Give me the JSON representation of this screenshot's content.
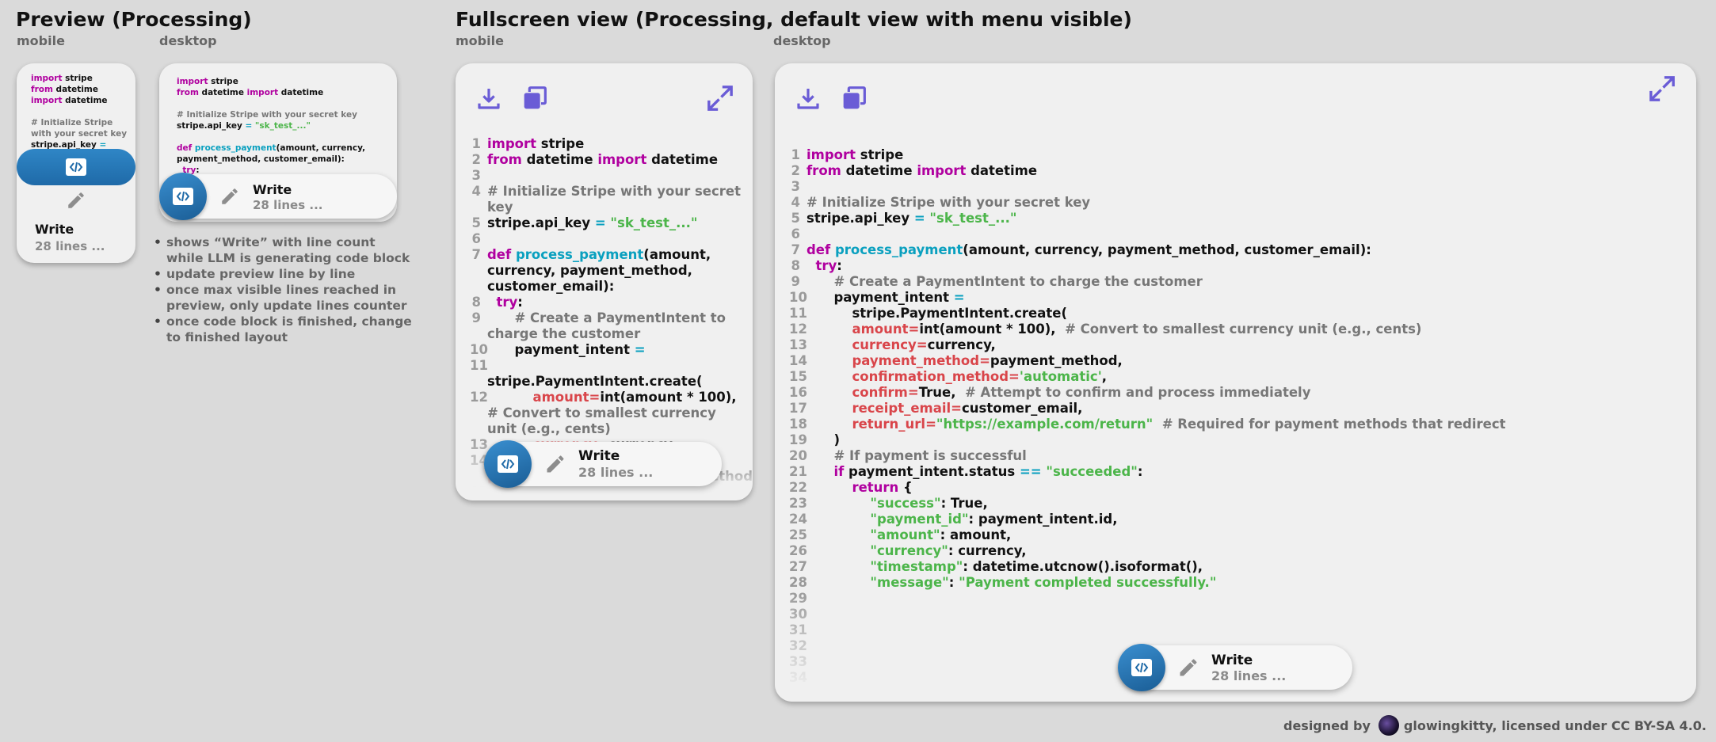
{
  "headings": {
    "preview": "Preview (Processing)",
    "fullscreen": "Fullscreen view (Processing, default view with menu visible)",
    "mobile": "mobile",
    "desktop": "desktop"
  },
  "write": {
    "title": "Write",
    "lines": "28 lines ..."
  },
  "notes": [
    "shows “Write” with line count while LLM is generating code block",
    "update preview line by line",
    "once max visible lines reached in preview, only update lines counter",
    "once code block is finished, change to finished layout"
  ],
  "credit": {
    "designed_by": "designed by",
    "author": "glowingkitty, licensed under CC BY-SA 4.0."
  },
  "icons": {
    "download": "download-icon",
    "copy": "copy-icon",
    "fullscreen": "expand-icon",
    "code": "code-icon",
    "edit": "pencil-icon"
  },
  "colors": {
    "keyword": "#b0009f",
    "function": "#0aa0bf",
    "string": "#4cb54a",
    "comment": "#777777",
    "param": "#d9454a",
    "accent": "#1a5d95",
    "icon": "#6a5cd6"
  },
  "code": [
    {
      "n": "1",
      "t": [
        [
          "kw",
          "import"
        ],
        [
          "",
          "stripe"
        ]
      ]
    },
    {
      "n": "2",
      "t": [
        [
          "kw",
          "from"
        ],
        [
          "",
          " datetime "
        ],
        [
          "kw",
          "import"
        ],
        [
          "",
          " datetime"
        ]
      ]
    },
    {
      "n": "3",
      "t": []
    },
    {
      "n": "4",
      "t": [
        [
          "cm",
          "# Initialize Stripe with your secret key"
        ]
      ]
    },
    {
      "n": "5",
      "t": [
        [
          "",
          "stripe.api_key "
        ],
        [
          "op",
          "="
        ],
        [
          "str",
          " \"sk_test_...\""
        ]
      ]
    },
    {
      "n": "6",
      "t": []
    },
    {
      "n": "7",
      "t": [
        [
          "kw",
          "def "
        ],
        [
          "fn",
          "process_payment"
        ],
        [
          "",
          "(amount, currency, payment_method, customer_email):"
        ]
      ]
    },
    {
      "n": "8",
      "t": [
        [
          "",
          "  "
        ],
        [
          "kw",
          "try"
        ],
        [
          "",
          ":"
        ]
      ]
    },
    {
      "n": "9",
      "t": [
        [
          "",
          "      "
        ],
        [
          "cm",
          "# Create a PaymentIntent to charge the customer"
        ]
      ]
    },
    {
      "n": "10",
      "t": [
        [
          "",
          "      payment_intent "
        ],
        [
          "op",
          "="
        ]
      ]
    },
    {
      "n": "11",
      "t": [
        [
          "",
          "          stripe.PaymentIntent.create("
        ]
      ]
    },
    {
      "n": "12",
      "t": [
        [
          "",
          "          "
        ],
        [
          "par",
          "amount="
        ],
        [
          "",
          "int(amount * 100),  "
        ],
        [
          "cm",
          "# Convert to smallest currency unit (e.g., cents)"
        ]
      ]
    },
    {
      "n": "13",
      "t": [
        [
          "",
          "          "
        ],
        [
          "par",
          "currency="
        ],
        [
          "",
          "currency,"
        ]
      ]
    },
    {
      "n": "14",
      "t": [
        [
          "",
          "          "
        ],
        [
          "par",
          "payment_method="
        ],
        [
          "",
          "payment_method,"
        ]
      ]
    },
    {
      "n": "15",
      "t": [
        [
          "",
          "          "
        ],
        [
          "par",
          "confirmation_method="
        ],
        [
          "str",
          "'automatic'"
        ],
        [
          "",
          ","
        ]
      ]
    },
    {
      "n": "16",
      "t": [
        [
          "",
          "          "
        ],
        [
          "par",
          "confirm="
        ],
        [
          "",
          "True,  "
        ],
        [
          "cm",
          "# Attempt to confirm and process immediately"
        ]
      ]
    },
    {
      "n": "17",
      "t": [
        [
          "",
          "          "
        ],
        [
          "par",
          "receipt_email="
        ],
        [
          "",
          "customer_email,"
        ]
      ]
    },
    {
      "n": "18",
      "t": [
        [
          "",
          "          "
        ],
        [
          "par",
          "return_url="
        ],
        [
          "str",
          "\"https://example.com/return\""
        ],
        [
          "",
          "  "
        ],
        [
          "cm",
          "# Required for payment methods that redirect"
        ]
      ]
    },
    {
      "n": "19",
      "t": [
        [
          "",
          "      )"
        ]
      ]
    },
    {
      "n": "20",
      "t": [
        [
          "",
          "      "
        ],
        [
          "cm",
          "# If payment is successful"
        ]
      ]
    },
    {
      "n": "21",
      "t": [
        [
          "",
          "      "
        ],
        [
          "kw",
          "if"
        ],
        [
          "",
          " payment_intent.status "
        ],
        [
          "op",
          "=="
        ],
        [
          "str",
          " \"succeeded\""
        ],
        [
          "",
          ":"
        ]
      ]
    },
    {
      "n": "22",
      "t": [
        [
          "",
          "          "
        ],
        [
          "kw",
          "return"
        ],
        [
          "",
          " {"
        ]
      ]
    },
    {
      "n": "23",
      "t": [
        [
          "",
          "              "
        ],
        [
          "str",
          "\"success\""
        ],
        [
          "",
          ": True,"
        ]
      ]
    },
    {
      "n": "24",
      "t": [
        [
          "",
          "              "
        ],
        [
          "str",
          "\"payment_id\""
        ],
        [
          "",
          ": payment_intent.id,"
        ]
      ]
    },
    {
      "n": "25",
      "t": [
        [
          "",
          "              "
        ],
        [
          "str",
          "\"amount\""
        ],
        [
          "",
          ": amount,"
        ]
      ]
    },
    {
      "n": "26",
      "t": [
        [
          "",
          "              "
        ],
        [
          "str",
          "\"currency\""
        ],
        [
          "",
          ": currency,"
        ]
      ]
    },
    {
      "n": "27",
      "t": [
        [
          "",
          "              "
        ],
        [
          "str",
          "\"timestamp\""
        ],
        [
          "",
          ": datetime.utcnow().isoformat(),"
        ]
      ]
    },
    {
      "n": "28",
      "t": [
        [
          "",
          "              "
        ],
        [
          "str",
          "\"message\""
        ],
        [
          "",
          ": "
        ],
        [
          "str",
          "\"Payment completed successfully.\""
        ]
      ]
    },
    {
      "n": "29",
      "t": []
    },
    {
      "n": "30",
      "t": []
    },
    {
      "n": "31",
      "t": []
    },
    {
      "n": "32",
      "t": []
    },
    {
      "n": "33",
      "t": []
    },
    {
      "n": "34",
      "t": []
    }
  ]
}
